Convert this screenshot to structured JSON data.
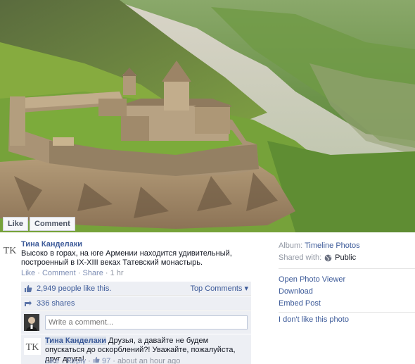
{
  "photo": {
    "like_label": "Like",
    "comment_label": "Comment"
  },
  "post": {
    "author": "Тина Канделаки",
    "avatar_monogram": "TK",
    "caption_line1": "Высоко в горах, на юге Армении находится удивительный,",
    "caption_line2": "построенный в IX-XIII веках Татевский монастырь.",
    "meta": {
      "like": "Like",
      "comment": "Comment",
      "share": "Share",
      "time": "1 hr",
      "separator": "·"
    }
  },
  "ufi": {
    "likes_text": "2,949 people like this.",
    "top_comments": "Top Comments ▾",
    "shares_text": "336 shares",
    "write_placeholder": "Write a comment..."
  },
  "comment": {
    "author": "Тина Канделаки",
    "text": " Друзья, а давайте не будем опускаться до оскорблений?! Уважайте, пожалуйста, друг друга!",
    "like": "Like",
    "reply": "Reply",
    "likes_count": "97",
    "time": "about an hour ago",
    "separator": "·"
  },
  "sidebar": {
    "album_label": "Album:",
    "album_value": "Timeline Photos",
    "shared_label": "Shared with:",
    "shared_value": "Public",
    "actions": [
      "Open Photo Viewer",
      "Download",
      "Embed Post"
    ],
    "dislike": "I don't like this photo"
  },
  "colors": {
    "link": "#3b5998",
    "ufi_bg": "#edeff4",
    "muted": "#9197a3"
  },
  "icons": {
    "like": "thumbs-up-icon",
    "share": "share-icon",
    "globe": "globe-icon"
  }
}
